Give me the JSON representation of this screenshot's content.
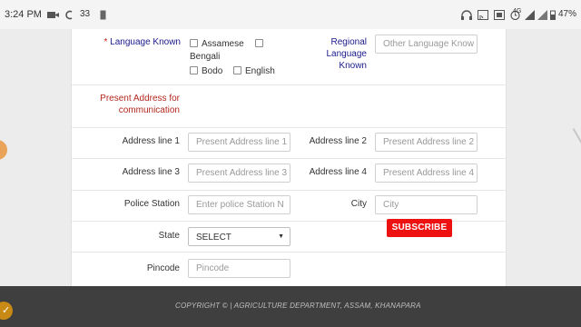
{
  "status_bar": {
    "time": "3:24 PM",
    "temperature": "33",
    "network": "4G",
    "battery": "47%"
  },
  "form": {
    "language_known": {
      "required_mark": "*",
      "label": "Language Known",
      "options": [
        "Assamese",
        "Bengali",
        "Bodo",
        "English"
      ]
    },
    "regional_language": {
      "label_lines": [
        "Regional",
        "Language",
        "Known"
      ],
      "placeholder": "Other Language Know"
    },
    "present_address_heading_lines": [
      "Present Address for",
      "communication"
    ],
    "address_line1": {
      "label": "Address line 1",
      "placeholder": "Present Address line 1"
    },
    "address_line2": {
      "label": "Address line 2",
      "placeholder": "Present Address line 2"
    },
    "address_line3": {
      "label": "Address line 3",
      "placeholder": "Present Address line 3"
    },
    "address_line4": {
      "label": "Address line 4",
      "placeholder": "Present Address line 4"
    },
    "police_station": {
      "label": "Police Station",
      "placeholder": "Enter police Station N"
    },
    "city": {
      "label": "City",
      "placeholder": "City"
    },
    "state": {
      "label": "State",
      "selected": "SELECT"
    },
    "pincode": {
      "label": "Pincode",
      "placeholder": "Pincode"
    }
  },
  "overlay": {
    "subscribe_label": "SUBSCRIBE"
  },
  "footer": {
    "text": "COPYRIGHT © | AGRICULTURE DEPARTMENT, ASSAM, KHANAPARA"
  },
  "colors": {
    "label_blue": "#1a1a8c",
    "heading_red": "#b3261e",
    "subscribe_red": "#ee1111",
    "footer_bg": "#3f3f3f"
  }
}
